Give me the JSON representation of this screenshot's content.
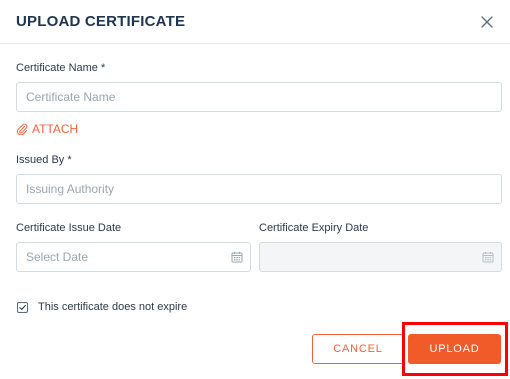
{
  "dialog": {
    "title": "UPLOAD CERTIFICATE",
    "close_icon": "close-icon"
  },
  "form": {
    "certificate_name": {
      "label": "Certificate Name *",
      "placeholder": "Certificate Name",
      "value": ""
    },
    "attach": {
      "label": "ATTACH",
      "icon": "paperclip-icon"
    },
    "issued_by": {
      "label": "Issued By *",
      "placeholder": "Issuing Authority",
      "value": ""
    },
    "issue_date": {
      "label": "Certificate Issue Date",
      "placeholder": "Select Date",
      "value": "",
      "icon": "calendar-icon"
    },
    "expiry_date": {
      "label": "Certificate Expiry Date",
      "placeholder": "",
      "value": "",
      "disabled": true,
      "icon": "calendar-icon"
    },
    "no_expiry": {
      "label": "This certificate does not expire",
      "checked": true
    }
  },
  "actions": {
    "cancel_label": "CANCEL",
    "upload_label": "UPLOAD"
  },
  "colors": {
    "accent": "#f15a29",
    "title": "#1f3550",
    "border": "#d6dbe2",
    "highlight": "#ff0000"
  }
}
